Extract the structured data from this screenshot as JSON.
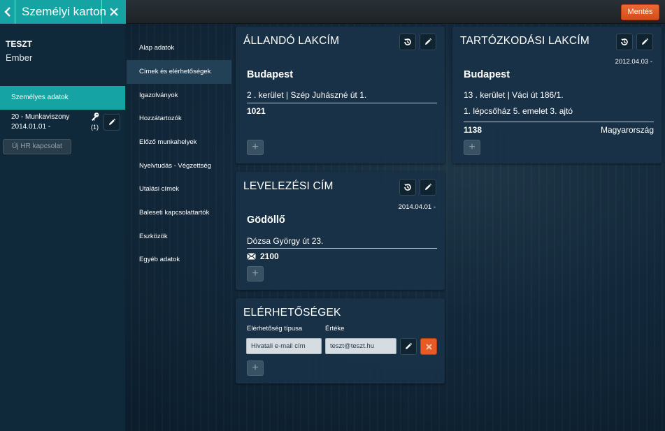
{
  "topbar": {
    "title": "Személyi karton",
    "save_label": "Mentés"
  },
  "sidebar": {
    "user_name": "TESZT",
    "user_sub": "Ember",
    "active_item": "Személyes adatok",
    "hr_relation": {
      "line1": "20 - Munkaviszony",
      "line2": "2014.01.01 -",
      "count": "(1)"
    },
    "new_hr_label": "Új HR kapcsolat"
  },
  "subnav": {
    "items": [
      {
        "label": "Alap adatok"
      },
      {
        "label": "Címek és elérhetőségek"
      },
      {
        "label": "Igazolványok"
      },
      {
        "label": "Hozzátartozók"
      },
      {
        "label": "Előző munkahelyek"
      },
      {
        "label": "Nyelvtudás - Végzettség"
      },
      {
        "label": "Utalási címek"
      },
      {
        "label": "Baleseti kapcsolattartók"
      },
      {
        "label": "Eszközök"
      },
      {
        "label": "Egyéb adatok"
      }
    ],
    "active_index": 1
  },
  "permanent_address": {
    "title": "ÁLLANDÓ LAKCÍM",
    "city": "Budapest",
    "street": "2 . kerület | Szép Juhászné út 1.",
    "zip": "1021"
  },
  "temporary_address": {
    "title": "TARTÓZKODÁSI LAKCÍM",
    "date": "2012.04.03 -",
    "city": "Budapest",
    "street": "13 . kerület | Váci út 186/1.",
    "street2": "1. lépcsőház 5. emelet 3. ajtó",
    "zip": "1138",
    "country": "Magyarország"
  },
  "mailing_address": {
    "title": "LEVELEZÉSI CÍM",
    "date": "2014.04.01 -",
    "city": "Gödöllő",
    "street": "Dózsa György út 23.",
    "zip": "2100"
  },
  "contacts": {
    "title": "ELÉRHETŐSÉGEK",
    "type_label": "Elérhetőség típusa",
    "value_label": "Értéke",
    "type_value": "Hivatali e-mail cím",
    "value_value": "teszt@teszt.hu"
  },
  "icons": {
    "history": "history-icon",
    "edit": "pencil-icon",
    "add": "+",
    "delete": "close-icon",
    "mail": "envelope-icon",
    "key": "key-icon"
  },
  "colors": {
    "accent": "#16a3a4",
    "save": "#e0592a",
    "card": "#193248"
  }
}
